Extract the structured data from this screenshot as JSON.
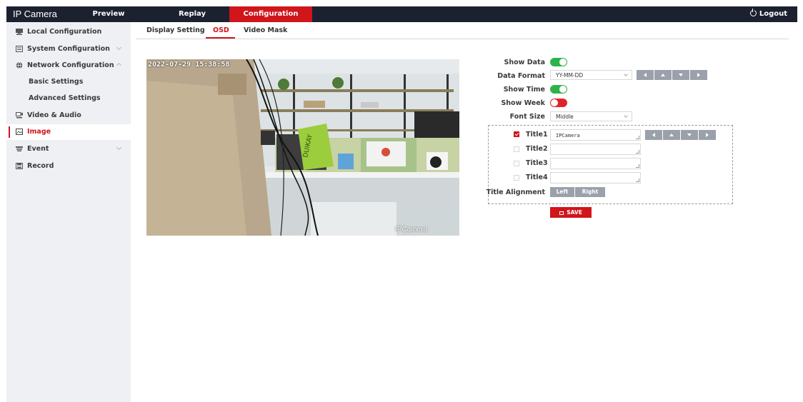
{
  "app": {
    "brand": "IP Camera",
    "nav": {
      "preview": "Preview",
      "replay": "Replay",
      "configuration": "Configuration",
      "logout": "Logout"
    }
  },
  "sidebar": {
    "items": [
      {
        "label": "Local Configuration",
        "icon": "local-config-icon"
      },
      {
        "label": "System Configuration",
        "icon": "system-config-icon",
        "expandable": true
      },
      {
        "label": "Network Configuration",
        "icon": "globe-icon",
        "expanded": true
      },
      {
        "label": "Video & Audio",
        "icon": "video-audio-icon"
      },
      {
        "label": "Image",
        "icon": "image-icon",
        "active": true
      },
      {
        "label": "Event",
        "icon": "event-icon",
        "expandable": true
      },
      {
        "label": "Record",
        "icon": "record-icon"
      }
    ],
    "network_sub": [
      "Basic Settings",
      "Advanced Settings"
    ]
  },
  "tabs": [
    "Display Setting",
    "OSD",
    "Video Mask"
  ],
  "active_tab": "OSD",
  "preview": {
    "osd_date": "2022-07-29 15:38:58",
    "osd_title": "IPCamera",
    "box_label": "DUIKAY"
  },
  "osd": {
    "show_data_label": "Show Data",
    "show_data": true,
    "data_format_label": "Data Format",
    "data_format": "YY-MM-DD",
    "show_time_label": "Show Time",
    "show_time": true,
    "show_week_label": "Show Week",
    "show_week": false,
    "font_size_label": "Font Size",
    "font_size": "Middle",
    "titles": [
      {
        "label": "Title1",
        "checked": true,
        "value": "IPCamera"
      },
      {
        "label": "Title2",
        "checked": false,
        "value": ""
      },
      {
        "label": "Title3",
        "checked": false,
        "value": ""
      },
      {
        "label": "Title4",
        "checked": false,
        "value": ""
      }
    ],
    "title_alignment_label": "Title Alignment",
    "alignment_options": [
      "Left",
      "Right"
    ],
    "save_label": "SAVE"
  },
  "colors": {
    "accent": "#d0151b",
    "topbar": "#1c2130",
    "toggle_on": "#2db34a",
    "toggle_off": "#e0242c"
  }
}
